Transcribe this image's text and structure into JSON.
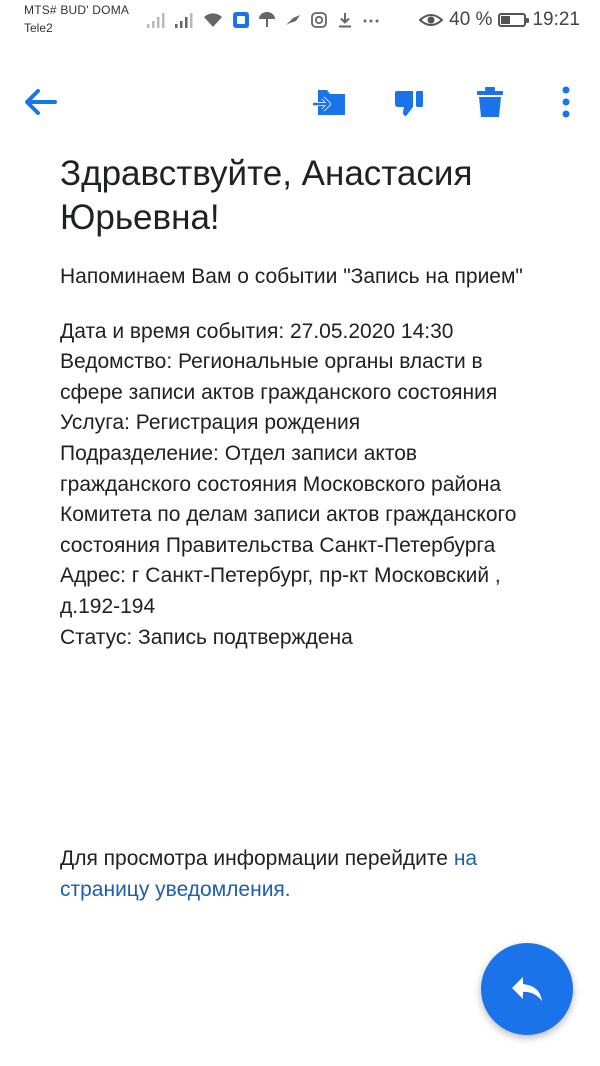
{
  "status_bar": {
    "carrier_1": "MTS# BUD' DOMA",
    "carrier_2": "Tele2",
    "battery_percent": "40 %",
    "battery_level": 0.4,
    "time": "19:21"
  },
  "toolbar": {
    "icons": [
      "back-arrow-icon",
      "move-to-folder-icon",
      "dislike-icon",
      "trash-icon",
      "more-vert-icon"
    ],
    "accent_color": "#1a73e8"
  },
  "message": {
    "greeting": "Здравствуйте, Анастасия Юрьевна!",
    "intro": "Напоминаем Вам о событии \"Запись на прием\"",
    "details": [
      "Дата и время события: 27.05.2020 14:30",
      "Ведомство: Региональные органы власти в сфере записи актов гражданского состояния",
      "Услуга: Регистрация рождения",
      "Подразделение: Отдел записи актов гражданского состояния Московского района Комитета по делам записи актов гражданского состояния Правительства Санкт-Петербурга",
      "Адрес: г Санкт-Петербург, пр-кт Московский , д.192-194",
      "Статус: Запись подтверждена"
    ],
    "footer_text": "Для просмотра информации перейдите ",
    "footer_link": "на страницу уведомления.",
    "link_color": "#1d5fa8"
  },
  "fab": {
    "icon": "reply-icon",
    "color": "#1a73e8"
  }
}
